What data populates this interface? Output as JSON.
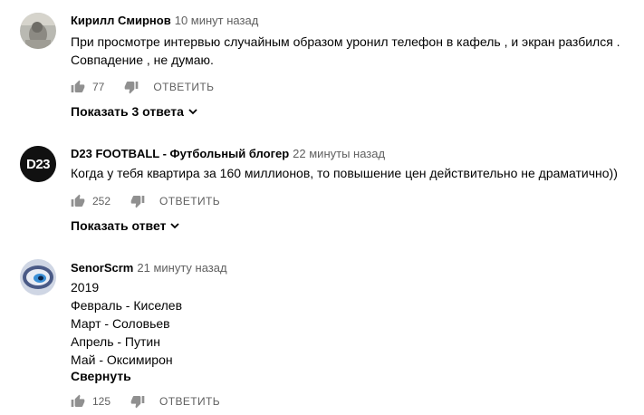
{
  "comments": [
    {
      "author": "Кирилл Смирнов",
      "time": "10 минут назад",
      "lines": [
        "При просмотре интервью случайным образом уронил телефон в кафель , и экран разбился .",
        "Совпадение , не думаю."
      ],
      "likes": "77",
      "reply_label": "ОТВЕТИТЬ",
      "replies_label": "Показать 3 ответа"
    },
    {
      "author": "D23 FOOTBALL - Футбольный блогер",
      "time": "22 минуты назад",
      "avatar_text": "D23",
      "lines": [
        "Когда у тебя квартира за 160 миллионов, то повышение цен действительно не драматично))"
      ],
      "likes": "252",
      "reply_label": "ОТВЕТИТЬ",
      "replies_label": "Показать ответ"
    },
    {
      "author": "SenorScrm",
      "time": "21 минуту назад",
      "lines": [
        "2019",
        "Февраль - Киселев",
        "Март - Соловьев",
        "Апрель - Путин",
        "Май - Оксимирон"
      ],
      "collapse_label": "Свернуть",
      "likes": "125",
      "reply_label": "ОТВЕТИТЬ"
    }
  ],
  "icons": {
    "like": "thumb-up-icon",
    "dislike": "thumb-down-icon",
    "chevron": "chevron-down-icon"
  },
  "colors": {
    "secondary_text": "#606060",
    "primary_text": "#030303",
    "icon": "#909090"
  }
}
